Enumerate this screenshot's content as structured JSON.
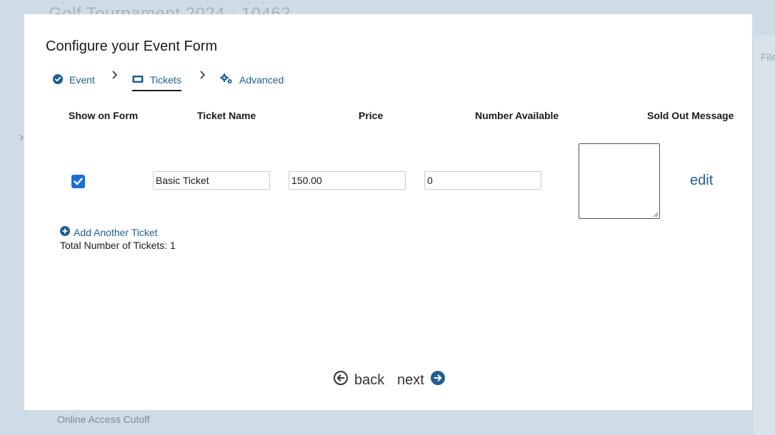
{
  "background": {
    "title": "Golf Tournament 2024 - 10462",
    "files_label": "Files",
    "cutoff_label": "Online Access Cutoff"
  },
  "modal": {
    "title": "Configure your Event Form",
    "steps": [
      {
        "label": "Event",
        "icon": "check-circle-icon",
        "state": "completed"
      },
      {
        "label": "Tickets",
        "icon": "ticket-icon",
        "state": "active"
      },
      {
        "label": "Advanced",
        "icon": "gears-icon",
        "state": "pending"
      }
    ],
    "table": {
      "headers": [
        "Show on Form",
        "Ticket Name",
        "Price",
        "Number Available",
        "Sold Out Message"
      ],
      "rows": [
        {
          "show_on_form": true,
          "ticket_name": "Basic Ticket",
          "price": "150.00",
          "number_available": "0",
          "sold_out_message": "",
          "action": "edit"
        }
      ]
    },
    "add_ticket_label": "Add Another Ticket",
    "total_label": "Total Number of Tickets: 1",
    "nav": {
      "back_label": "back",
      "next_label": "next"
    }
  },
  "colors": {
    "accent": "#1f5f8e",
    "checkbox": "#1c6fd1",
    "backdrop": "#cfdce6"
  }
}
